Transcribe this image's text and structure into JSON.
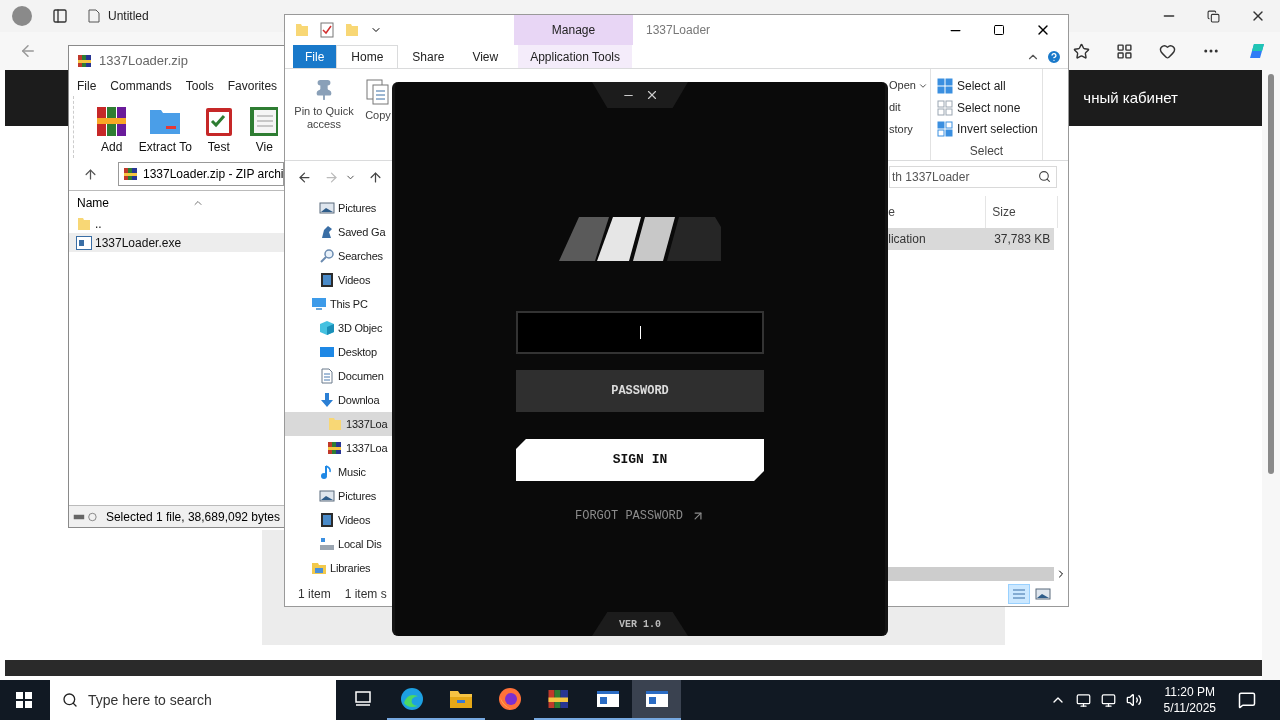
{
  "browser": {
    "tabs": [
      {
        "label": "Untitled"
      }
    ],
    "banner_text": "чный кабинет"
  },
  "winrar": {
    "title": "1337Loader.zip",
    "menu": [
      "File",
      "Commands",
      "Tools",
      "Favorites"
    ],
    "toolbar": [
      {
        "label": "Add",
        "kind": "add"
      },
      {
        "label": "Extract To",
        "kind": "extract"
      },
      {
        "label": "Test",
        "kind": "test"
      },
      {
        "label": "Vie",
        "kind": "view"
      }
    ],
    "path": "1337Loader.zip - ZIP archi",
    "columns": [
      "Name"
    ],
    "files": [
      {
        "name": "..",
        "kind": "folder",
        "selected": false
      },
      {
        "name": "1337Loader.exe",
        "kind": "exe",
        "selected": true
      }
    ],
    "status": "Selected 1 file, 38,689,092 bytes"
  },
  "explorer": {
    "title": "1337Loader",
    "context_label": "Manage",
    "tabs": [
      {
        "label": "File",
        "kind": "file",
        "selected": false
      },
      {
        "label": "Home",
        "kind": "tab",
        "selected": true
      },
      {
        "label": "Share",
        "kind": "tab",
        "selected": false
      },
      {
        "label": "View",
        "kind": "tab",
        "selected": false
      },
      {
        "label": "Application Tools",
        "kind": "context",
        "selected": false
      }
    ],
    "ribbon_left": [
      {
        "label": "Pin to Quick access",
        "kind": "pin"
      },
      {
        "label": "Copy",
        "kind": "copy"
      }
    ],
    "open_group": [
      "Open",
      "dit",
      "story"
    ],
    "select_group": {
      "label": "Select",
      "items": [
        {
          "label": "Select all",
          "kind": "all"
        },
        {
          "label": "Select none",
          "kind": "none"
        },
        {
          "label": "Invert selection",
          "kind": "invert"
        }
      ]
    },
    "search_placeholder": "th 1337Loader",
    "nav": [
      {
        "children": [
          {
            "label": "Pictures",
            "kind": "pictures",
            "selected": false
          },
          {
            "label": "Saved Ga",
            "kind": "games",
            "selected": false
          },
          {
            "label": "Searches",
            "kind": "search",
            "selected": false
          },
          {
            "label": "Videos",
            "kind": "videos",
            "selected": false
          }
        ]
      },
      {
        "label": "This PC",
        "kind": "pc",
        "selected": false,
        "children": [
          {
            "label": "3D Objec",
            "kind": "cube",
            "selected": false
          },
          {
            "label": "Desktop",
            "kind": "desktop",
            "selected": false
          },
          {
            "label": "Documen",
            "kind": "document",
            "selected": false
          },
          {
            "label": "Downloa",
            "kind": "download",
            "selected": false,
            "children": [
              {
                "label": "1337Loa",
                "kind": "folder",
                "selected": true
              },
              {
                "label": "1337Loa",
                "kind": "archive",
                "selected": false
              }
            ]
          },
          {
            "label": "Music",
            "kind": "music",
            "selected": false
          },
          {
            "label": "Pictures",
            "kind": "pictures",
            "selected": false
          },
          {
            "label": "Videos",
            "kind": "videos",
            "selected": false
          },
          {
            "label": "Local Dis",
            "kind": "drive",
            "selected": false
          }
        ]
      },
      {
        "label": "Libraries",
        "kind": "libraries",
        "selected": false
      }
    ],
    "columns": [
      "e",
      "Size"
    ],
    "files": [
      {
        "type": "lication",
        "size": "37,783 KB",
        "selected": true
      }
    ],
    "status": [
      "1 item",
      "1 item s"
    ]
  },
  "loader": {
    "username_field": {
      "focused": true
    },
    "password_placeholder": "PASSWORD",
    "sign_in": "SIGN IN",
    "forgot": "FORGOT PASSWORD",
    "version": "VER 1.0"
  },
  "taskbar": {
    "search_placeholder": "Type here to search",
    "apps": [
      {
        "kind": "taskview",
        "running": false,
        "active": false
      },
      {
        "kind": "edge",
        "running": true,
        "active": false
      },
      {
        "kind": "explorer",
        "running": true,
        "active": false
      },
      {
        "kind": "firefox",
        "running": false,
        "active": false
      },
      {
        "kind": "winrar",
        "running": true,
        "active": false
      },
      {
        "kind": "window",
        "running": true,
        "active": false
      },
      {
        "kind": "window",
        "running": true,
        "active": true
      }
    ],
    "time": "11:20 PM",
    "date": "5/11/2025"
  }
}
